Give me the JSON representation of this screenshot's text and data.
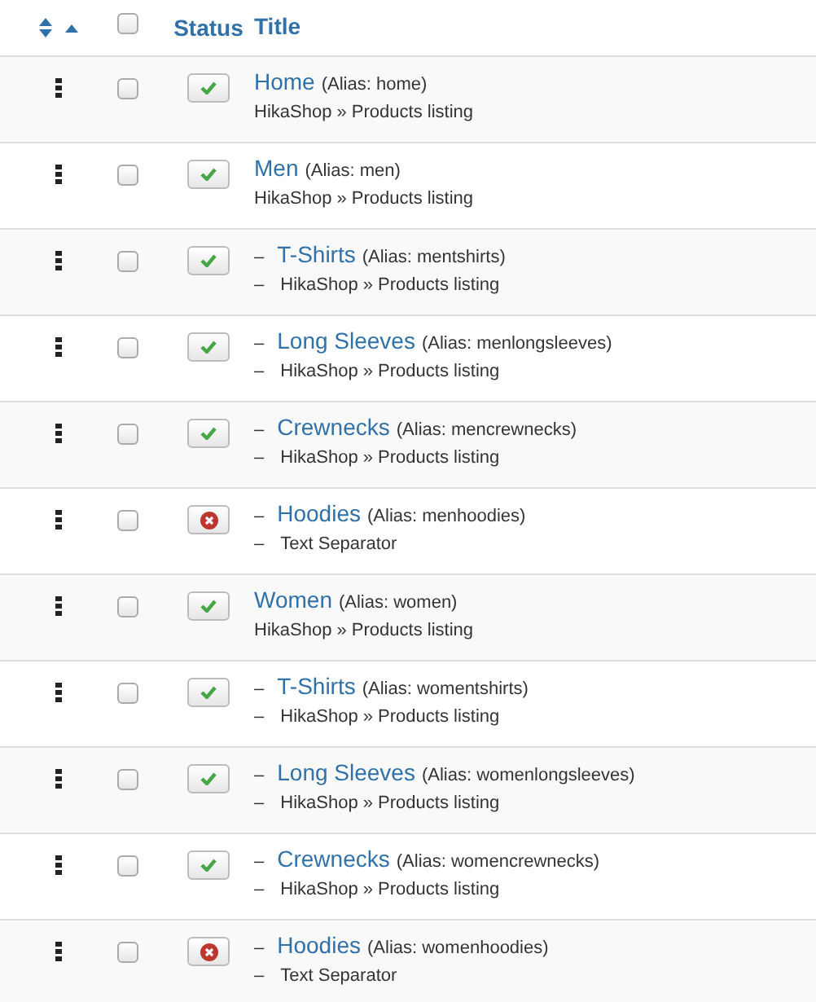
{
  "table": {
    "columns": {
      "status": "Status",
      "title": "Title"
    },
    "select_all": {
      "checked": false
    },
    "rows": [
      {
        "title": "Home",
        "alias": "(Alias: home)",
        "type": "HikaShop » Products listing",
        "published": true,
        "checked": false
      },
      {
        "title": "Men",
        "alias": "(Alias: men)",
        "type": "HikaShop » Products listing",
        "published": true,
        "checked": false,
        "children": [
          {
            "dash": "–",
            "title": "T-Shirts",
            "alias": "(Alias: mentshirts)",
            "type_dash": "–",
            "type": "HikaShop » Products listing",
            "published": true,
            "checked": false
          },
          {
            "dash": "–",
            "title": "Long Sleeves",
            "alias": "(Alias: menlongsleeves)",
            "type_dash": "–",
            "type": "HikaShop » Products listing",
            "published": true,
            "checked": false
          },
          {
            "dash": "–",
            "title": "Crewnecks",
            "alias": "(Alias: mencrewnecks)",
            "type_dash": "–",
            "type": "HikaShop » Products listing",
            "published": true,
            "checked": false
          },
          {
            "dash": "–",
            "title": "Hoodies",
            "alias": "(Alias: menhoodies)",
            "type_dash": "–",
            "type": "Text Separator",
            "published": false,
            "checked": false
          }
        ]
      },
      {
        "title": "Women",
        "alias": "(Alias: women)",
        "type": "HikaShop » Products listing",
        "published": true,
        "checked": false,
        "children": [
          {
            "dash": "–",
            "title": "T-Shirts",
            "alias": "(Alias: womentshirts)",
            "type_dash": "–",
            "type": "HikaShop » Products listing",
            "published": true,
            "checked": false
          },
          {
            "dash": "–",
            "title": "Long Sleeves",
            "alias": "(Alias: womenlongsleeves)",
            "type_dash": "–",
            "type": "HikaShop » Products listing",
            "published": true,
            "checked": false
          },
          {
            "dash": "–",
            "title": "Crewnecks",
            "alias": "(Alias: womencrewnecks)",
            "type_dash": "–",
            "type": "HikaShop » Products listing",
            "published": true,
            "checked": false
          },
          {
            "dash": "–",
            "title": "Hoodies",
            "alias": "(Alias: womenhoodies)",
            "type_dash": "–",
            "type": "Text Separator",
            "published": false,
            "checked": false
          }
        ]
      }
    ]
  }
}
